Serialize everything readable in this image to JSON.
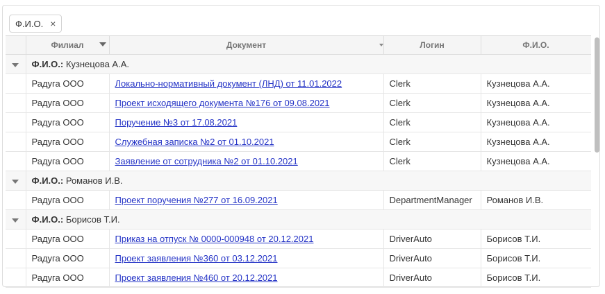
{
  "group_panel": {
    "chip_label": "Ф.И.О.",
    "close_icon": "×"
  },
  "columns": [
    "Филиал",
    "Документ",
    "Логин",
    "Ф.И.О."
  ],
  "groups": [
    {
      "key": "Ф.И.О.:",
      "value": "Кузнецова А.А.",
      "rows": [
        {
          "branch": "Радуга ООО",
          "document": "Локально-нормативный документ (ЛНД) от 11.01.2022",
          "login": "Clerk",
          "fio": "Кузнецова А.А."
        },
        {
          "branch": "Радуга ООО",
          "document": "Проект исходящего документа №176 от 09.08.2021",
          "login": "Clerk",
          "fio": "Кузнецова А.А."
        },
        {
          "branch": "Радуга ООО",
          "document": "Поручение №3 от 17.08.2021",
          "login": "Clerk",
          "fio": "Кузнецова А.А."
        },
        {
          "branch": "Радуга ООО",
          "document": "Служебная записка №2 от 01.10.2021",
          "login": "Clerk",
          "fio": "Кузнецова А.А."
        },
        {
          "branch": "Радуга ООО",
          "document": "Заявление от сотрудника №2 от 01.10.2021",
          "login": "Clerk",
          "fio": "Кузнецова А.А."
        }
      ]
    },
    {
      "key": "Ф.И.О.:",
      "value": "Романов И.В.",
      "rows": [
        {
          "branch": "Радуга ООО",
          "document": "Проект поручения №277 от 16.09.2021",
          "login": "DepartmentManager",
          "fio": "Романов И.В."
        }
      ]
    },
    {
      "key": "Ф.И.О.:",
      "value": "Борисов Т.И.",
      "rows": [
        {
          "branch": "Радуга ООО",
          "document": "Приказ на отпуск № 0000-000948 от 20.12.2021",
          "login": "DriverAuto",
          "fio": "Борисов Т.И."
        },
        {
          "branch": "Радуга ООО",
          "document": "Проект заявления №360 от 03.12.2021",
          "login": "DriverAuto",
          "fio": "Борисов Т.И."
        },
        {
          "branch": "Радуга ООО",
          "document": "Проект заявления №460 от 20.12.2021",
          "login": "DriverAuto",
          "fio": "Борисов Т.И."
        }
      ]
    }
  ]
}
